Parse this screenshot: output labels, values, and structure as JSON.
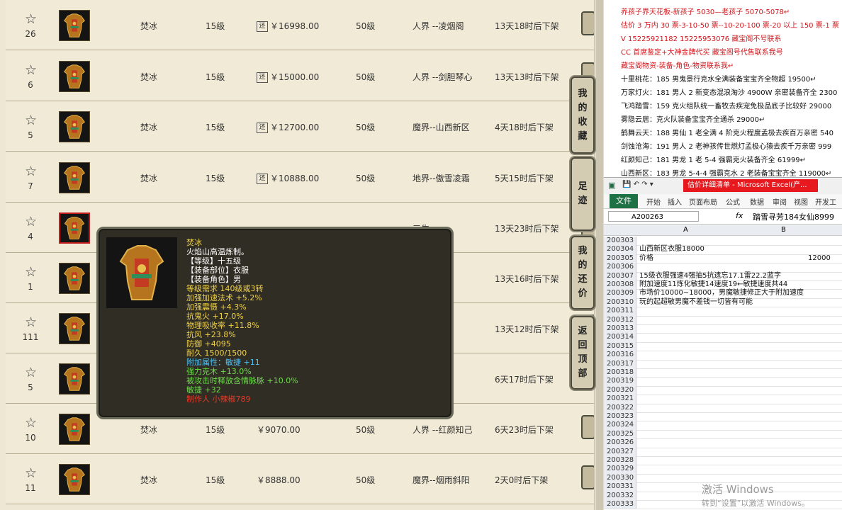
{
  "market": {
    "rows": [
      {
        "fav": "26",
        "name": "焚冰",
        "level": "15级",
        "price": "￥16998.00",
        "returnable": true,
        "grade": "50级",
        "server": "人界 --凌烟阁",
        "time": "13天18时后下架"
      },
      {
        "fav": "6",
        "name": "焚冰",
        "level": "15级",
        "price": "￥15000.00",
        "returnable": true,
        "grade": "50级",
        "server": "人界 --剑胆琴心",
        "time": "13天13时后下架"
      },
      {
        "fav": "5",
        "name": "焚冰",
        "level": "15级",
        "price": "￥12700.00",
        "returnable": true,
        "grade": "50级",
        "server": "魔界--山西新区",
        "time": "4天18时后下架"
      },
      {
        "fav": "7",
        "name": "焚冰",
        "level": "15级",
        "price": "￥10888.00",
        "returnable": true,
        "grade": "50级",
        "server": "地界--傲雪凌霜",
        "time": "5天15时后下架"
      },
      {
        "fav": "4",
        "name": "",
        "level": "",
        "price": "",
        "returnable": false,
        "grade": "",
        "server": "三生",
        "time": "13天23时后下架",
        "highlight": true
      },
      {
        "fav": "1",
        "name": "",
        "level": "",
        "price": "",
        "returnable": false,
        "grade": "",
        "server": "烟阁",
        "time": "13天16时后下架"
      },
      {
        "fav": "111",
        "name": "",
        "level": "",
        "price": "",
        "returnable": false,
        "grade": "",
        "server": "若有情",
        "time": "13天12时后下架"
      },
      {
        "fav": "5",
        "name": "",
        "level": "",
        "price": "",
        "returnable": false,
        "grade": "",
        "server": "三生",
        "time": "6天17时后下架"
      },
      {
        "fav": "10",
        "name": "焚冰",
        "level": "15级",
        "price": "￥9070.00",
        "returnable": false,
        "grade": "50级",
        "server": "人界 --红颜知己",
        "time": "6天23时后下架"
      },
      {
        "fav": "11",
        "name": "焚冰",
        "level": "15级",
        "price": "￥8888.00",
        "returnable": false,
        "grade": "50级",
        "server": "魔界--烟雨斜阳",
        "time": "2天0时后下架"
      }
    ],
    "return_badge": "还",
    "side_buttons": [
      {
        "label": "我的收藏"
      },
      {
        "label": "足迹"
      },
      {
        "label": "我的还价"
      },
      {
        "label": "返回顶部"
      }
    ]
  },
  "tooltip": {
    "lines": [
      {
        "text": "焚冰",
        "color": "#f0d24a"
      },
      {
        "text": "火焰山高温炼制。",
        "color": "#ffffff"
      },
      {
        "text": "【等级】十五级",
        "color": "#ffffff"
      },
      {
        "text": "【装备部位】衣服",
        "color": "#ffffff"
      },
      {
        "text": "【装备角色】男",
        "color": "#ffffff"
      },
      {
        "text": "等级需求 140级或3转",
        "color": "#f0d24a"
      },
      {
        "text": "加强加速法术 +5.2%",
        "color": "#f0d24a"
      },
      {
        "text": "加强震慑 +4.3%",
        "color": "#f0d24a"
      },
      {
        "text": "抗鬼火 +17.0%",
        "color": "#f0d24a"
      },
      {
        "text": "物理吸收率 +11.8%",
        "color": "#f0d24a"
      },
      {
        "text": "抗风 +23.8%",
        "color": "#f0d24a"
      },
      {
        "text": "防御 +4095",
        "color": "#f0d24a"
      },
      {
        "text": "耐久 1500/1500",
        "color": "#f0d24a"
      },
      {
        "text": "附加属性：敏捷 +11",
        "color": "#4fc3f7"
      },
      {
        "text": "强力克木 +13.0%",
        "color": "#6ddc4a"
      },
      {
        "text": "被攻击时释放含情脉脉 +10.0%",
        "color": "#6ddc4a"
      },
      {
        "text": "敏捷 +32",
        "color": "#6ddc4a"
      },
      {
        "text": "制作人 小辣椒789",
        "color": "#e23a2a"
      }
    ]
  },
  "chat": {
    "lines": [
      {
        "text": "养孩子界天花板-新孩子 5030—老孩子 5070-5078↵",
        "color": "#d0161b"
      },
      {
        "text": "估价 3 万内 30 票-3-10-50 票--10-20-100 票-20 以上 150 票-1 票",
        "color": "#d0161b"
      },
      {
        "text": "V 15225921182      15225953076   藏宝阁不号联系",
        "color": "#d0161b"
      },
      {
        "text": "CC 首席鉴定+大神金牌代买 藏宝阁号代售联系我号",
        "color": "#d0161b"
      },
      {
        "text": "藏宝阁物资-装备-角色-物资联系我↵",
        "color": "#d0161b"
      },
      {
        "text": "十里桃花：185 男鬼景行克水全满装备宝宝齐全物超 19500↵",
        "color": "#111111"
      },
      {
        "text": "万家灯火：181 男人 2 新变态混浪淘沙 4900W 亲密装备齐全 2300",
        "color": "#111111"
      },
      {
        "text": "飞鸿踏雪：159 克火组队统一畜牧去疾宠免极品底子比较好 29000",
        "color": "#111111"
      },
      {
        "text": "雾隐云居：克火队装备宝宝齐全通杀 29000↵",
        "color": "#111111"
      },
      {
        "text": "鹤舞云天：188 男仙 1 老全满 4 阶克火程度孟极去疾百万亲密 540",
        "color": "#111111"
      },
      {
        "text": "剑蚀沧海：191 男人 2 老神孩传世燃灯孟极心猿去疾千万亲密 999",
        "color": "#111111"
      },
      {
        "text": "红颜知己：181 男龙 1 老 5-4 强霸克火装备齐全 61999↵",
        "color": "#111111"
      },
      {
        "text": "山西新区：183 男龙 5-4-4 强霸克水 2 老装备宝宝齐全 119000↵",
        "color": "#111111"
      }
    ]
  },
  "excel": {
    "title": "估价详细清单 - Microsoft Excel(产...",
    "tabs": [
      "开始",
      "插入",
      "页面布局",
      "公式",
      "数据",
      "审阅",
      "视图",
      "开发工具"
    ],
    "file_tab": "文件",
    "name_box": "A200263",
    "fx": "fx",
    "formula_value": "踏雪寻芳184女仙8999",
    "col_a": "A",
    "col_b": "B",
    "rows": [
      {
        "n": "200303",
        "a": "",
        "b": ""
      },
      {
        "n": "200304",
        "a": "山西新区衣服18000",
        "b": ""
      },
      {
        "n": "200305",
        "a": "价格",
        "b": "12000"
      },
      {
        "n": "200306",
        "a": "",
        "b": ""
      },
      {
        "n": "200307",
        "a": "15级衣服强速4强抽5抗遗忘17.1雷22.2蓝字",
        "b": ""
      },
      {
        "n": "200308",
        "a": "附加速度11炼化敏捷14速度19←敏捷速度共44",
        "b": ""
      },
      {
        "n": "200309",
        "a": "市场价10000~18000，男魔敏捷修正大于附加速度",
        "b": ""
      },
      {
        "n": "200310",
        "a": "玩的起超敏男魔不差钱一切皆有可能",
        "b": ""
      },
      {
        "n": "200311",
        "a": "",
        "b": ""
      },
      {
        "n": "200312",
        "a": "",
        "b": ""
      },
      {
        "n": "200313",
        "a": "",
        "b": ""
      },
      {
        "n": "200314",
        "a": "",
        "b": ""
      },
      {
        "n": "200315",
        "a": "",
        "b": ""
      },
      {
        "n": "200316",
        "a": "",
        "b": ""
      },
      {
        "n": "200317",
        "a": "",
        "b": ""
      },
      {
        "n": "200318",
        "a": "",
        "b": ""
      },
      {
        "n": "200319",
        "a": "",
        "b": ""
      },
      {
        "n": "200320",
        "a": "",
        "b": ""
      },
      {
        "n": "200321",
        "a": "",
        "b": ""
      },
      {
        "n": "200322",
        "a": "",
        "b": ""
      },
      {
        "n": "200323",
        "a": "",
        "b": ""
      },
      {
        "n": "200324",
        "a": "",
        "b": ""
      },
      {
        "n": "200325",
        "a": "",
        "b": ""
      },
      {
        "n": "200326",
        "a": "",
        "b": ""
      },
      {
        "n": "200327",
        "a": "",
        "b": ""
      },
      {
        "n": "200328",
        "a": "",
        "b": ""
      },
      {
        "n": "200329",
        "a": "",
        "b": ""
      },
      {
        "n": "200330",
        "a": "",
        "b": ""
      },
      {
        "n": "200331",
        "a": "",
        "b": ""
      },
      {
        "n": "200332",
        "a": "",
        "b": ""
      },
      {
        "n": "200333",
        "a": "",
        "b": ""
      }
    ]
  },
  "watermark": {
    "line1": "激活 Windows",
    "line2": "转到“设置”以激活 Windows。"
  }
}
